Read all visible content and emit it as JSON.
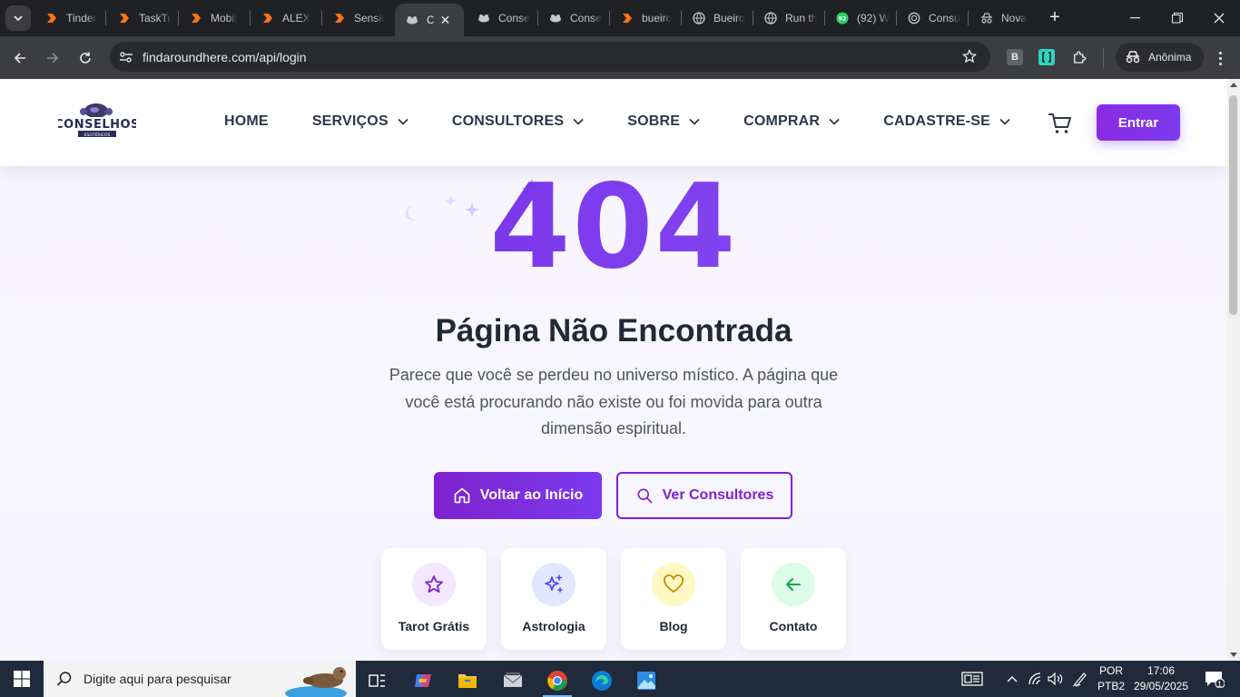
{
  "browser": {
    "tabs": [
      {
        "title": "Tinder",
        "icon": "orange-arrow-favicon",
        "active": false
      },
      {
        "title": "TaskTr",
        "icon": "orange-arrow-favicon",
        "active": false
      },
      {
        "title": "Mobil",
        "icon": "orange-arrow-favicon",
        "active": false
      },
      {
        "title": "ALEX",
        "icon": "orange-arrow-favicon",
        "active": false
      },
      {
        "title": "Sensit",
        "icon": "orange-arrow-favicon",
        "active": false
      },
      {
        "title": "C",
        "icon": "consult-favicon",
        "active": true
      },
      {
        "title": "Conse",
        "icon": "consult-favicon",
        "active": false
      },
      {
        "title": "Conse",
        "icon": "consult-favicon",
        "active": false
      },
      {
        "title": "bueiro",
        "icon": "orange-arrow-favicon",
        "active": false
      },
      {
        "title": "Bueiro",
        "icon": "globe-favicon",
        "active": false
      },
      {
        "title": "Run th",
        "icon": "globe-favicon",
        "active": false
      },
      {
        "title": "(92) W",
        "icon": "whatsapp-favicon",
        "badge": "92",
        "active": false
      },
      {
        "title": "Consu",
        "icon": "openai-favicon",
        "active": false
      },
      {
        "title": "Nova",
        "icon": "incognito-favicon",
        "active": false
      }
    ],
    "url": "findaroundhere.com/api/login",
    "profile_label": "Anônima",
    "extensions": [
      "b-extension-icon",
      "bracket-extension-icon",
      "puzzle-icon"
    ]
  },
  "header": {
    "logo_text": "CONSELHOS",
    "logo_subtext": "ESOTÉRICOS",
    "nav": [
      {
        "label": "HOME",
        "dropdown": false
      },
      {
        "label": "SERVIÇOS",
        "dropdown": true
      },
      {
        "label": "CONSULTORES",
        "dropdown": true
      },
      {
        "label": "SOBRE",
        "dropdown": true
      },
      {
        "label": "COMPRAR",
        "dropdown": true
      },
      {
        "label": "CADASTRE-SE",
        "dropdown": true
      }
    ],
    "login_label": "Entrar"
  },
  "error": {
    "code": "404",
    "title": "Página Não Encontrada",
    "description": "Parece que você se perdeu no universo místico. A página que você está procurando não existe ou foi movida para outra dimensão espiritual."
  },
  "actions": {
    "home_label": "Voltar ao Início",
    "consultants_label": "Ver Consultores"
  },
  "quick_links": [
    {
      "label": "Tarot Grátis",
      "icon": "star-icon",
      "bg": "#f3e8ff",
      "color": "#7e22ce"
    },
    {
      "label": "Astrologia",
      "icon": "sparkles-icon",
      "bg": "#e0e7ff",
      "color": "#4f46e5"
    },
    {
      "label": "Blog",
      "icon": "heart-icon",
      "bg": "#fef9c3",
      "color": "#ca8a04"
    },
    {
      "label": "Contato",
      "icon": "arrow-left-icon",
      "bg": "#dcfce7",
      "color": "#16a34a"
    }
  ],
  "colors": {
    "primary": "#7e22ce",
    "accent": "#7c3aed",
    "text_dark": "#1f2937",
    "text_muted": "#4b5563"
  },
  "taskbar": {
    "search_placeholder": "Digite aqui para pesquisar",
    "language": "POR",
    "keyboard": "PTB2",
    "time": "17:06",
    "date": "29/05/2025",
    "notification_count": "1"
  }
}
